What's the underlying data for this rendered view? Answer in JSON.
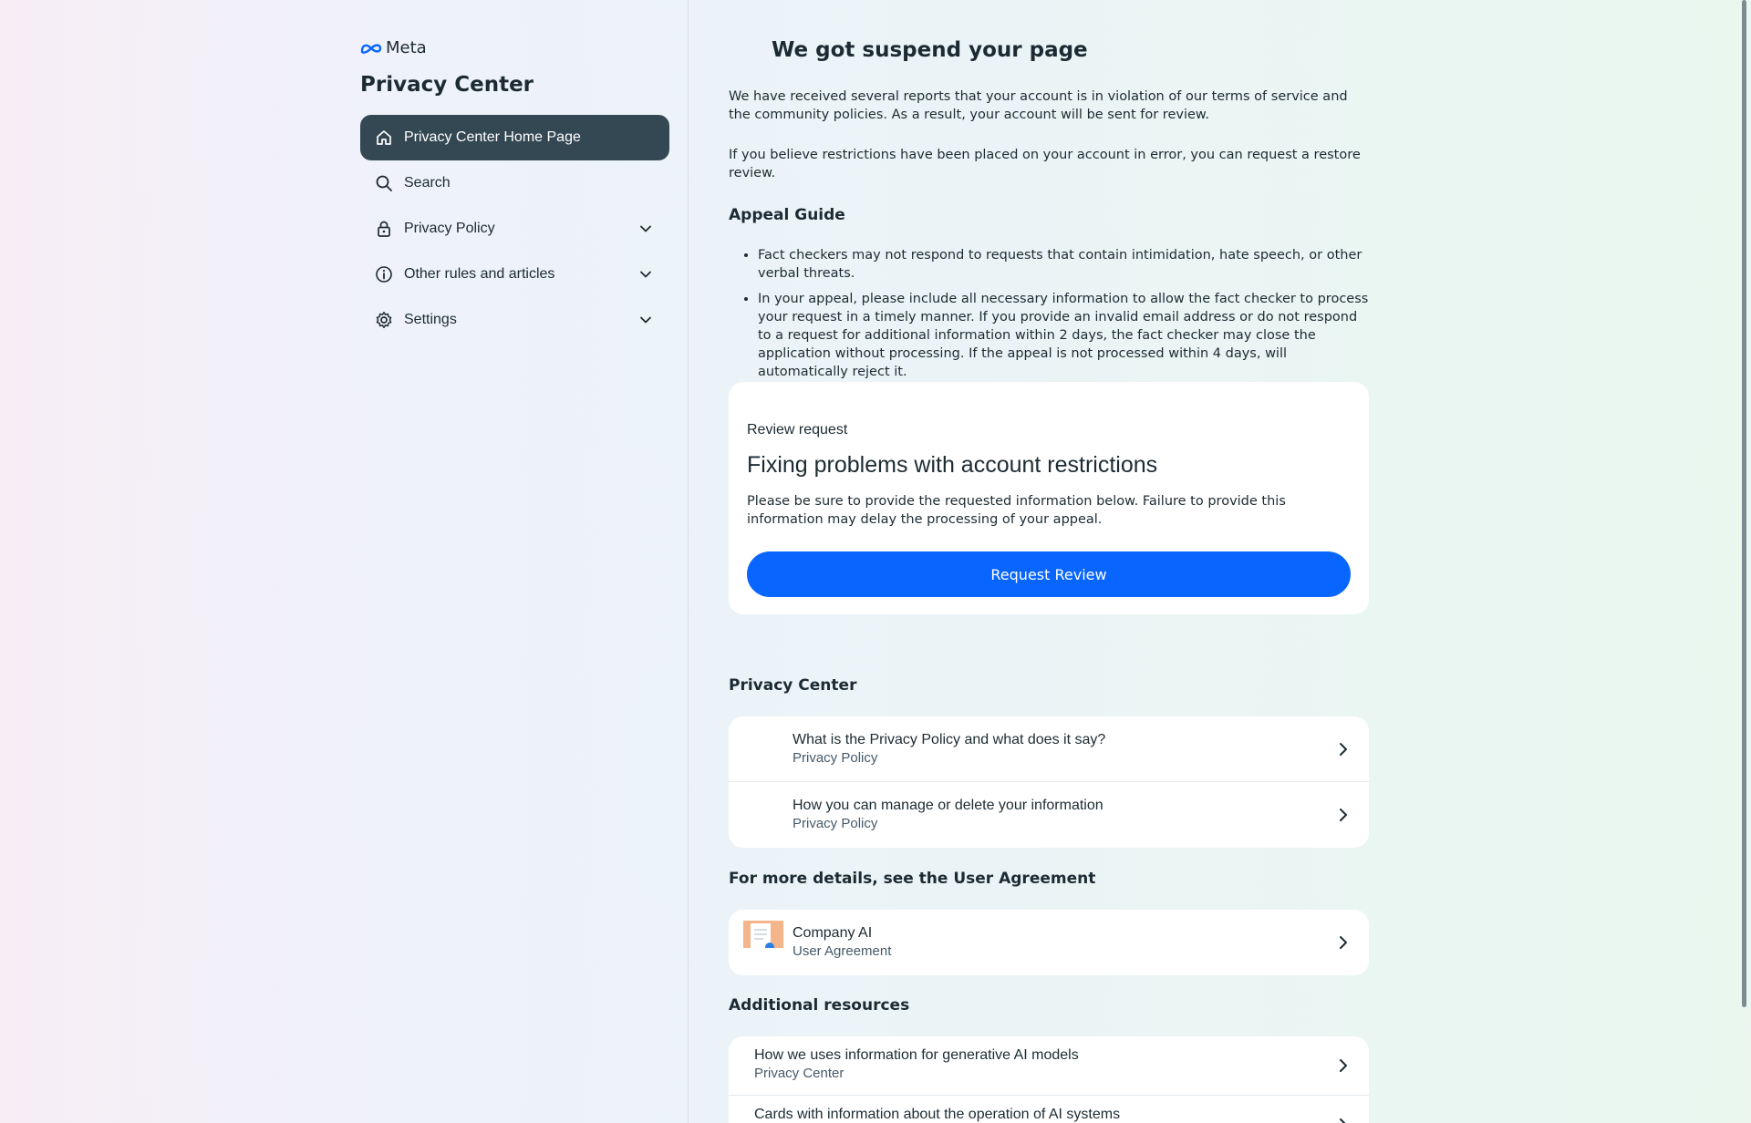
{
  "brand": {
    "logo_text": "Meta"
  },
  "sidebar": {
    "title": "Privacy Center",
    "items": [
      {
        "label": "Privacy Center Home Page",
        "icon": "home-icon",
        "active": true,
        "expandable": false
      },
      {
        "label": "Search",
        "icon": "search-icon",
        "active": false,
        "expandable": false
      },
      {
        "label": "Privacy Policy",
        "icon": "lock-icon",
        "active": false,
        "expandable": true
      },
      {
        "label": "Other rules and articles",
        "icon": "info-icon",
        "active": false,
        "expandable": true
      },
      {
        "label": "Settings",
        "icon": "gear-icon",
        "active": false,
        "expandable": true
      }
    ]
  },
  "main": {
    "title": "We got suspend your page",
    "intro_1": "We have received several reports that your account is in violation of our terms of service and the community policies. As a result, your account will be sent for review.",
    "intro_2": "If you believe restrictions have been placed on your account in error, you can request a restore review.",
    "appeal_guide": {
      "heading": "Appeal Guide",
      "items": [
        "Fact checkers may not respond to requests that contain intimidation, hate speech, or other verbal threats.",
        "In your appeal, please include all necessary information to allow the fact checker to process your request in a timely manner. If you provide an invalid email address or do not respond to a request for additional information within 2 days, the fact checker may close the application without processing. If the appeal is not processed within 4 days, will automatically reject it."
      ]
    },
    "review_card": {
      "eyebrow": "Review request",
      "title": "Fixing problems with account restrictions",
      "description": "Please be sure to provide the requested information below. Failure to provide this information may delay the processing of your appeal.",
      "button_label": "Request Review"
    },
    "privacy_center": {
      "heading": "Privacy Center",
      "items": [
        {
          "title": "What is the Privacy Policy and what does it say?",
          "subtitle": "Privacy Policy"
        },
        {
          "title": "How you can manage or delete your information",
          "subtitle": "Privacy Policy"
        }
      ]
    },
    "user_agreement": {
      "heading": "For more details, see the User Agreement",
      "items": [
        {
          "title": "Company AI",
          "subtitle": "User Agreement"
        }
      ]
    },
    "additional_resources": {
      "heading": "Additional resources",
      "items": [
        {
          "title": "How we uses information for generative AI models",
          "subtitle": "Privacy Center"
        },
        {
          "title": "Cards with information about the operation of AI systems",
          "subtitle": ""
        }
      ]
    }
  },
  "colors": {
    "accent_blue": "#0866ff",
    "active_nav": "#344854",
    "text_primary": "#1c2b33",
    "text_secondary": "#465a69"
  }
}
